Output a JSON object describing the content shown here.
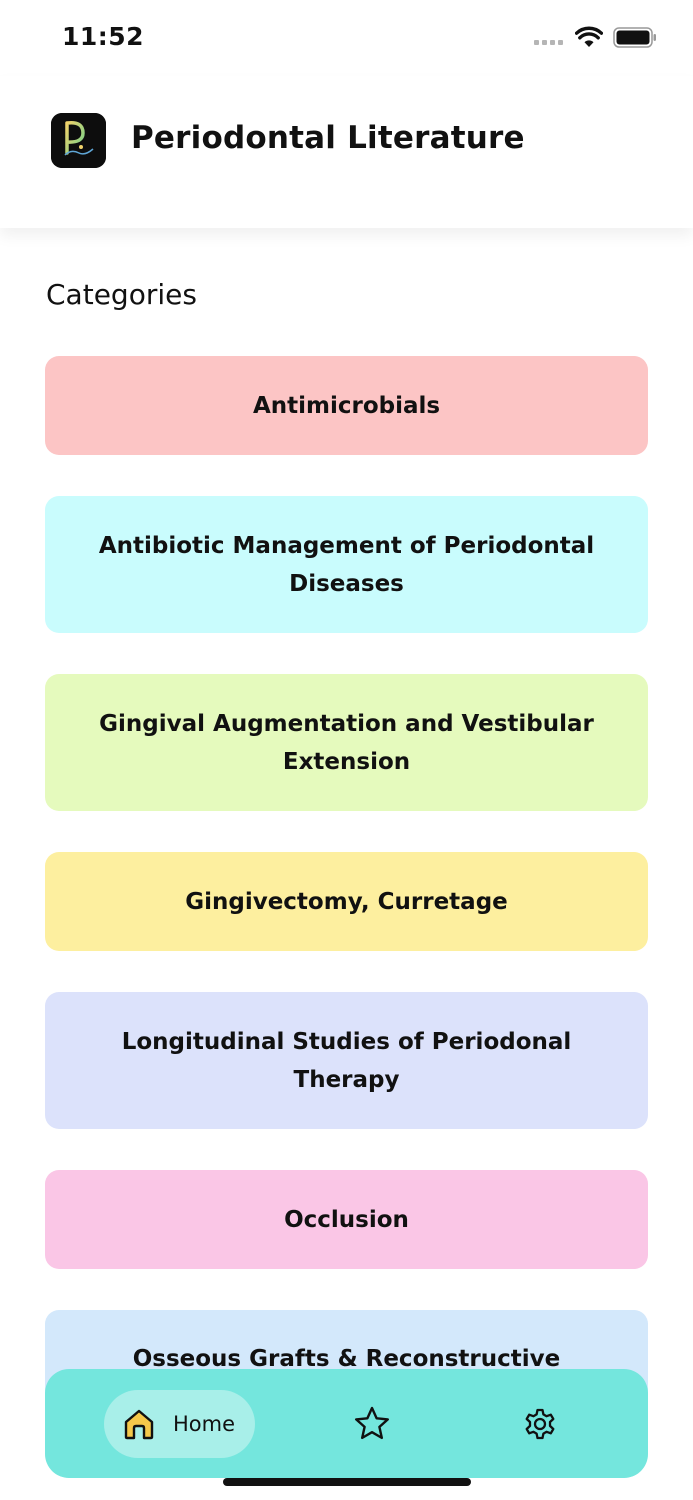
{
  "status_bar": {
    "time": "11:52"
  },
  "header": {
    "title": "Periodontal Literature",
    "logo_text": "Perio Lit"
  },
  "section": {
    "title": "Categories"
  },
  "categories": [
    {
      "label": "Antimicrobials",
      "color": "#fcc5c5"
    },
    {
      "label": "Antibiotic Management of Periodontal Diseases",
      "color": "#c9fcfd"
    },
    {
      "label": "Gingival Augmentation and Vestibular Extension",
      "color": "#e5fabd"
    },
    {
      "label": "Gingivectomy, Curretage",
      "color": "#fdef9f"
    },
    {
      "label": "Longitudinal Studies of Periodonal Therapy",
      "color": "#dce2fb"
    },
    {
      "label": "Occlusion",
      "color": "#fac6e6"
    },
    {
      "label": "Osseous Grafts & Reconstructive",
      "color": "#d3e8fb"
    }
  ],
  "bottom_nav": {
    "home_label": "Home",
    "background": "#74e6dd",
    "active_pill": "#a8efe9",
    "icons": {
      "home": "home-icon",
      "favorites": "star-icon",
      "settings": "gear-icon"
    }
  }
}
